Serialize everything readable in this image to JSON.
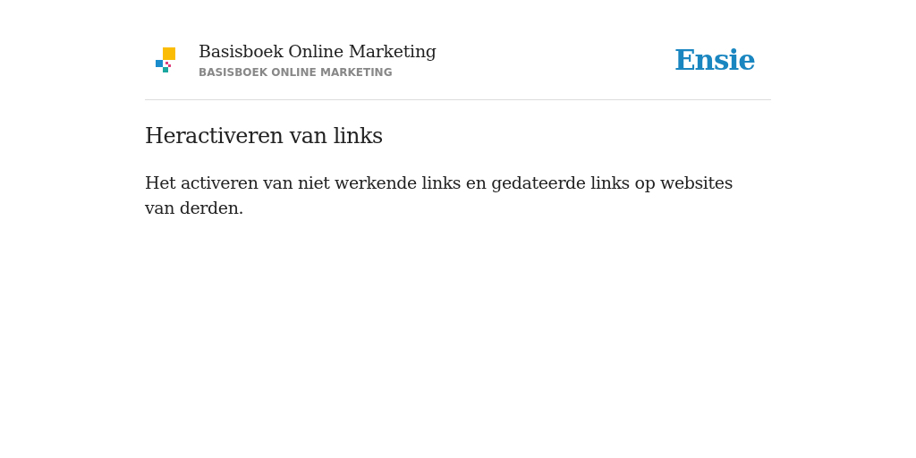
{
  "header": {
    "book_title": "Basisboek Online Marketing",
    "book_subtitle": "BASISBOEK ONLINE MARKETING",
    "brand": "Ensie"
  },
  "entry": {
    "term": "Heractiveren van links",
    "definition": "Het activeren van niet werkende links en gedateerde links op websites van derden."
  }
}
